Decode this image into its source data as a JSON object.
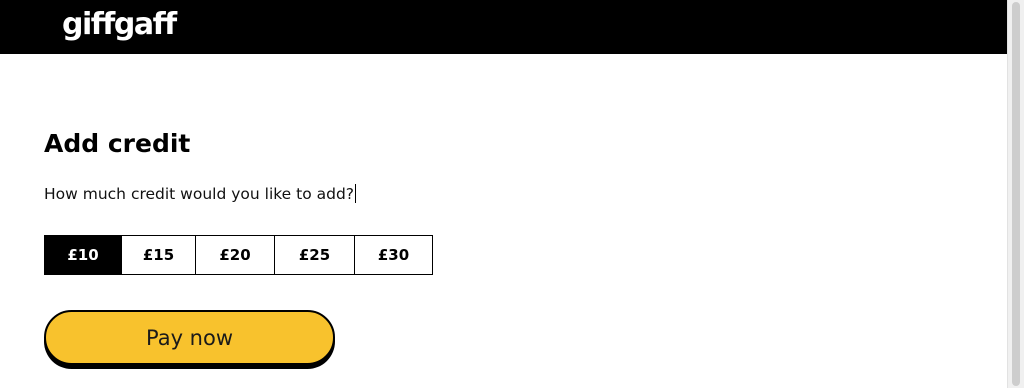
{
  "header": {
    "logo_text": "giffgaff"
  },
  "main": {
    "title": "Add credit",
    "question": "How much credit would you like to add?",
    "amounts": [
      {
        "label": "£10",
        "selected": true
      },
      {
        "label": "£15",
        "selected": false
      },
      {
        "label": "£20",
        "selected": false
      },
      {
        "label": "£25",
        "selected": false
      },
      {
        "label": "£30",
        "selected": false
      }
    ],
    "pay_button_label": "Pay now"
  },
  "colors": {
    "header_bg": "#000000",
    "accent_yellow": "#f8c22d",
    "selected_bg": "#000000",
    "selected_text": "#ffffff"
  }
}
